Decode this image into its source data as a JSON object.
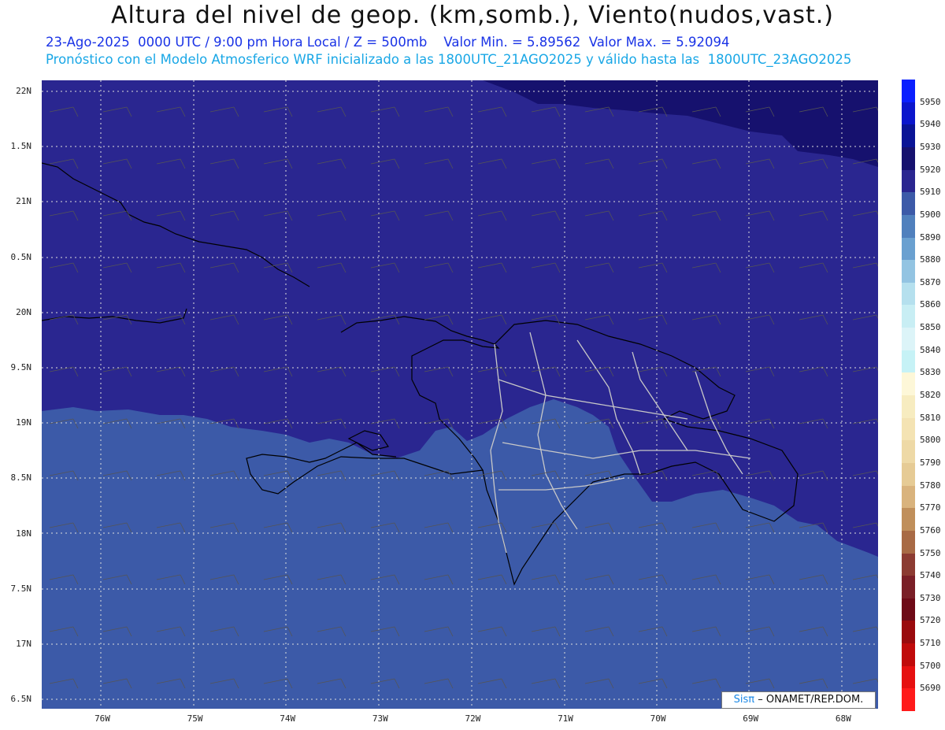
{
  "header": {
    "title": "Altura del nivel de geop. (km,somb.), Viento(nudos,vast.)",
    "date_line": "23-Ago-2025  0000 UTC / 9:00 pm Hora Local / Z = 500mb    Valor Min. = 5.89562  Valor Max. = 5.92094",
    "model_line": "Pronóstico con el Modelo Atmosferico WRF inicializado a las 1800UTC_21AGO2025 y válido hasta las  1800UTC_23AGO2025"
  },
  "lat_labels": [
    "22N",
    "1.5N",
    "21N",
    "0.5N",
    "20N",
    "9.5N",
    "19N",
    "8.5N",
    "18N",
    "7.5N",
    "17N",
    "6.5N"
  ],
  "lon_labels": [
    "76W",
    "75W",
    "74W",
    "73W",
    "72W",
    "71W",
    "70W",
    "69W",
    "68W"
  ],
  "colorbar": {
    "levels": [
      "5950",
      "5940",
      "5930",
      "5920",
      "5910",
      "5900",
      "5890",
      "5880",
      "5870",
      "5860",
      "5850",
      "5840",
      "5830",
      "5820",
      "5810",
      "5800",
      "5790",
      "5780",
      "5770",
      "5760",
      "5750",
      "5740",
      "5730",
      "5720",
      "5710",
      "5700",
      "5690"
    ],
    "colors": [
      "#0a1fff",
      "#0b16cc",
      "#0a1496",
      "#16116e",
      "#2a2690",
      "#3c5aa8",
      "#5080bd",
      "#6aa0d0",
      "#93c4e2",
      "#b5e0ee",
      "#c8eef4",
      "#dcf4f8",
      "#c6f2f6",
      "#fdf7d8",
      "#f7ecc0",
      "#f4e3b3",
      "#eed9a6",
      "#e6cb95",
      "#d9b37d",
      "#c08f5b",
      "#a86a45",
      "#8c3b32",
      "#7a1f27",
      "#6e0a17",
      "#9a0a0d",
      "#c00a0a",
      "#e61010",
      "#ff1a1a"
    ]
  },
  "credit": {
    "brand": "Sisπ",
    "text": "– ONAMET/REP.DOM."
  },
  "colors": {
    "dark_region": "#2a2690",
    "darker_region": "#16116e",
    "mid_region": "#3c5aa8",
    "coast": "#000000",
    "borders": "#c8c8c8"
  }
}
